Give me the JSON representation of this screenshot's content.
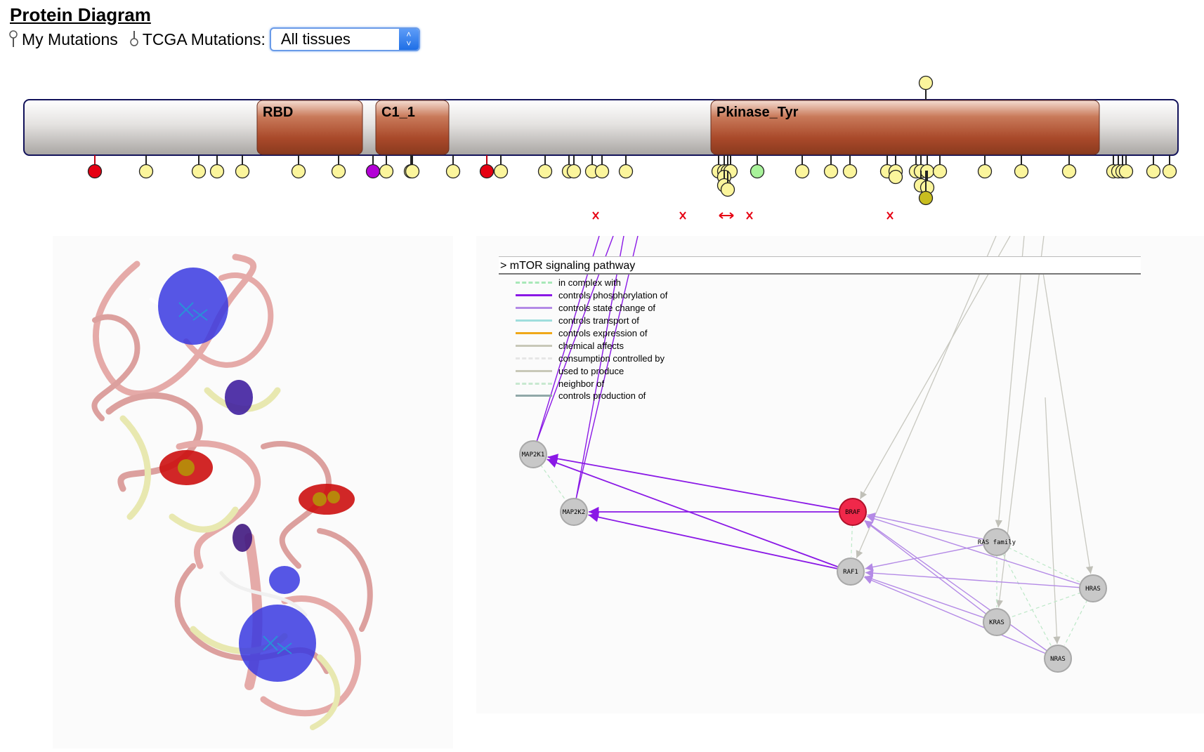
{
  "title": "Protein Diagram",
  "controls": {
    "my_mutations_label": "My Mutations",
    "tcga_mutations_label": "TCGA Mutations:",
    "tissue_select_value": "All tissues"
  },
  "protein": {
    "domains": [
      {
        "name": "RBD"
      },
      {
        "name": "C1_1"
      },
      {
        "name": "Pkinase_Tyr"
      }
    ],
    "colors": {
      "domain": "#b75a3a",
      "backbone": "#c9c5c2",
      "mutation_default": "#fbf59c",
      "mutation_red": "#e60012",
      "mutation_purple": "#b300d6",
      "mutation_green": "#a8f29a",
      "mutation_olive": "#c8bd1f",
      "cross": "#e60012"
    }
  },
  "pathway": {
    "header": "> mTOR signaling pathway",
    "legend": [
      {
        "label": "in complex with",
        "color": "#a8e8b8",
        "style": "dashed"
      },
      {
        "label": "controls phosphorylation of",
        "color": "#8a18e6",
        "style": "solid"
      },
      {
        "label": "controls state change of",
        "color": "#b48ae6",
        "style": "solid"
      },
      {
        "label": "controls transport of",
        "color": "#9fdedd",
        "style": "solid"
      },
      {
        "label": "controls expression of",
        "color": "#f0a818",
        "style": "solid"
      },
      {
        "label": "chemical affects",
        "color": "#c8c8b8",
        "style": "solid"
      },
      {
        "label": "consumption controlled by",
        "color": "#e6e6e6",
        "style": "dashed"
      },
      {
        "label": "used to produce",
        "color": "#c8c8b8",
        "style": "solid"
      },
      {
        "label": "neighbor of",
        "color": "#c8e8d0",
        "style": "dashed"
      },
      {
        "label": "controls production of",
        "color": "#90a8a8",
        "style": "solid"
      }
    ],
    "nodes": [
      {
        "id": "MAP2K1",
        "label": "MAP2K1"
      },
      {
        "id": "MAP2K2",
        "label": "MAP2K2"
      },
      {
        "id": "BRAF",
        "label": "BRAF"
      },
      {
        "id": "RAF1",
        "label": "RAF1"
      },
      {
        "id": "RAS_family",
        "label": "RAS family"
      },
      {
        "id": "HRAS",
        "label": "HRAS"
      },
      {
        "id": "KRAS",
        "label": "KRAS"
      },
      {
        "id": "NRAS",
        "label": "NRAS"
      }
    ],
    "colors": {
      "node": "#c8c8c8",
      "highlight": "#f0284a"
    }
  },
  "structure_image": {
    "icon": "protein-3d-ribbon-structure"
  }
}
